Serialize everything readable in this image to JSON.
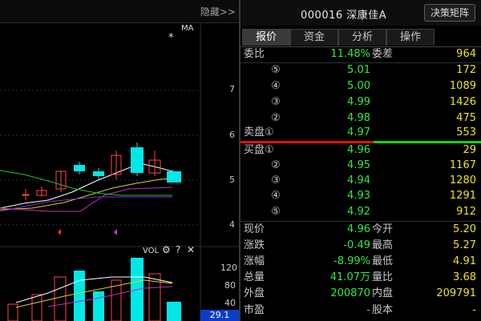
{
  "left_panel": {
    "hide_label": "隐藏>>",
    "ma_label": "MA",
    "asterisk": "*",
    "price_axis": [
      "7",
      "6",
      "5",
      "4"
    ],
    "vol_header": "VOL",
    "vol_axis": [
      "120",
      "80",
      "40"
    ],
    "vol_highlight": "29.1"
  },
  "header": {
    "stock_title": "000016 深康佳A",
    "decision_button": "决策矩阵"
  },
  "tabs": [
    "报价",
    "资金",
    "分析",
    "操作"
  ],
  "weibi": {
    "label": "委比",
    "value": "11.48%",
    "diff_label": "委差",
    "diff_value": "964"
  },
  "sell_orders": [
    {
      "num": "⑤",
      "price": "5.01",
      "vol": "172"
    },
    {
      "num": "④",
      "price": "5.00",
      "vol": "1089"
    },
    {
      "num": "③",
      "price": "4.99",
      "vol": "1426"
    },
    {
      "num": "②",
      "price": "4.98",
      "vol": "475"
    },
    {
      "num": "卖盘①",
      "price": "4.97",
      "vol": "553"
    }
  ],
  "buy_orders": [
    {
      "num": "买盘①",
      "price": "4.96",
      "vol": "29"
    },
    {
      "num": "②",
      "price": "4.95",
      "vol": "1167"
    },
    {
      "num": "③",
      "price": "4.94",
      "vol": "1280"
    },
    {
      "num": "④",
      "price": "4.93",
      "vol": "1291"
    },
    {
      "num": "⑤",
      "price": "4.92",
      "vol": "912"
    }
  ],
  "stats": [
    {
      "l1": "现价",
      "v1": "4.96",
      "c1": "g",
      "l2": "今开",
      "v2": "5.20",
      "c2": "g"
    },
    {
      "l1": "涨跌",
      "v1": "-0.49",
      "c1": "g",
      "l2": "最高",
      "v2": "5.27",
      "c2": "g"
    },
    {
      "l1": "涨幅",
      "v1": "-8.99%",
      "c1": "g",
      "l2": "最低",
      "v2": "4.91",
      "c2": "g"
    },
    {
      "l1": "总量",
      "v1": "41.07万",
      "c1": "y",
      "l2": "量比",
      "v2": "3.68",
      "c2": "w"
    },
    {
      "l1": "外盘",
      "v1": "200870",
      "c1": "r",
      "l2": "内盘",
      "v2": "209791",
      "c2": "g"
    },
    {
      "l1": "市盈",
      "v1": "-",
      "c1": "w",
      "l2": "股本",
      "v2": "-",
      "c2": "w"
    }
  ],
  "colors": {
    "up": "#ff4444",
    "down": "#33e64a",
    "volume": "#f0e020",
    "bg": "#000000"
  }
}
